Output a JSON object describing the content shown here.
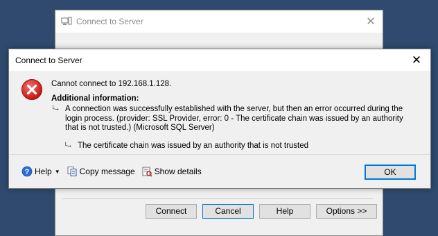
{
  "background_dialog": {
    "title": "Connect to Server",
    "close_glyph": "✕",
    "buttons": {
      "connect": "Connect",
      "cancel": "Cancel",
      "help": "Help",
      "options": "Options >>"
    }
  },
  "error_dialog": {
    "title": "Connect to Server",
    "close_glyph": "✕",
    "icon": "error-icon",
    "message": "Cannot connect to 192.168.1.128.",
    "additional_heading": "Additional information:",
    "detail": "A connection was successfully established with the server, but then an error occurred during the login process. (provider: SSL Provider, error: 0 - The certificate chain was issued by an authority that is not trusted.) (Microsoft SQL Server)",
    "inner_detail": "The certificate chain was issued by an authority that is not trusted",
    "footer": {
      "help": "Help",
      "copy_message": "Copy message",
      "show_details": "Show details",
      "ok": "OK"
    }
  },
  "colors": {
    "desktop": "#2f4a6e",
    "dialog_bg": "#f0f0f0",
    "accent": "#0078d7",
    "error_red": "#d9221c"
  }
}
